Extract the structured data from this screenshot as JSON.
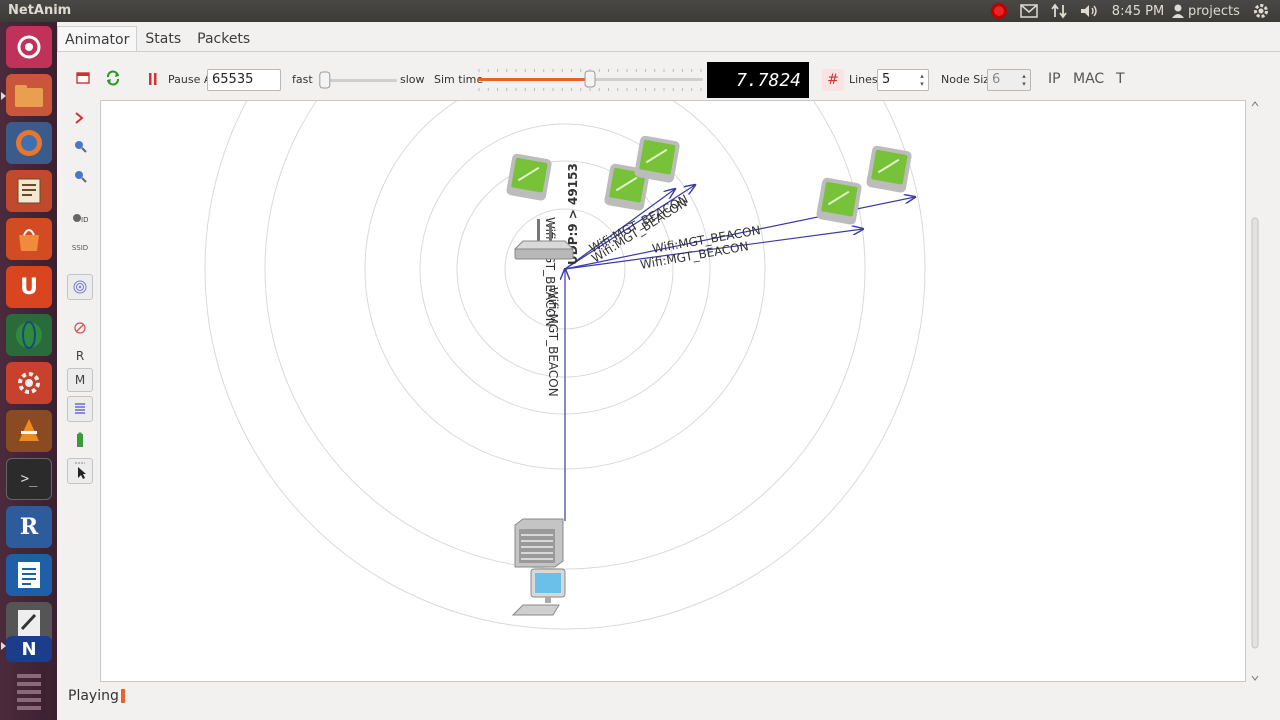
{
  "window": {
    "title": "NetAnim"
  },
  "panel": {
    "time": "8:45 PM",
    "user": "projects"
  },
  "tabs": [
    {
      "label": "Animator",
      "active": true
    },
    {
      "label": "Stats",
      "active": false
    },
    {
      "label": "Packets",
      "active": false
    }
  ],
  "toolbar": {
    "pause_at_label": "Pause At",
    "pause_at_value": "65535",
    "fast_label": "fast",
    "slow_label": "slow",
    "sim_time_label": "Sim time",
    "sim_time_value": "7.7824",
    "speed_level": 0.05,
    "sim_time_level": 0.5,
    "lines_label": "Lines",
    "lines_value": "5",
    "node_size_label": "Node Size",
    "node_size_value": "6",
    "ip_label": "IP",
    "mac_label": "MAC",
    "t_label": "T"
  },
  "side_tools": {
    "r_label": "R",
    "m_label": "M",
    "ssid_label": "SSID"
  },
  "canvas": {
    "packet_labels": [
      "UDP:9 > 49153",
      "Wifi:MGT_BEACON",
      "Wifi:MGT_BEACON",
      "Wifi:MGT_BEACON",
      "Wifi:MGT_BEACON",
      "Wifi:MGT_BEACON",
      "Wifi:MGT_BEACON"
    ]
  },
  "status": {
    "text": "Playing"
  },
  "colors": {
    "packet_line": "#3a3aa8",
    "sim_slider": "#e8632c",
    "launcher_bg": "#3a2030"
  }
}
